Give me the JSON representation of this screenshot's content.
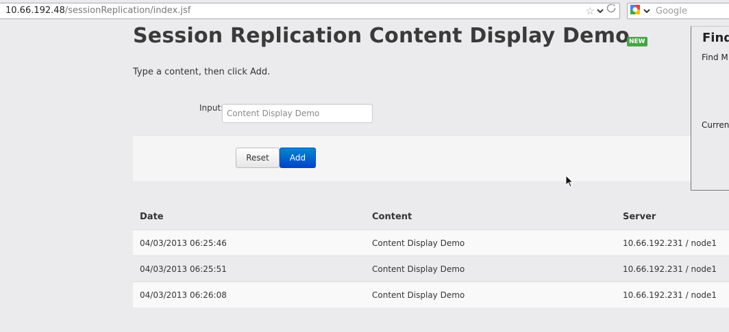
{
  "browser": {
    "url_host": "10.66.192.48",
    "url_path": "/sessionReplication/index.jsf",
    "search_placeholder": "Google"
  },
  "page": {
    "title": "Session Replication Content Display Demo",
    "badge": "NEW",
    "instructions": "Type a content, then click Add."
  },
  "form": {
    "input_label": "Input:",
    "input_placeholder": "Content Display Demo",
    "reset_label": "Reset",
    "add_label": "Add"
  },
  "table": {
    "headers": {
      "date": "Date",
      "content": "Content",
      "server": "Server"
    },
    "rows": [
      {
        "date": "04/03/2013 06:25:46",
        "content": "Content Display Demo",
        "server": "10.66.192.231 / node1"
      },
      {
        "date": "04/03/2013 06:25:51",
        "content": "Content Display Demo",
        "server": "10.66.192.231 / node1"
      },
      {
        "date": "04/03/2013 06:26:08",
        "content": "Content Display Demo",
        "server": "10.66.192.231 / node1"
      }
    ]
  },
  "find_panel": {
    "title": "Find",
    "subtitle": "Find M",
    "current": "Curren"
  },
  "colors": {
    "page_bg": "#ebebed",
    "badge_green": "#46a546",
    "primary_blue": "#0074cc"
  },
  "icons": [
    "bookmark-star-icon",
    "dropdown-chevron-icon",
    "reload-icon",
    "google-search-engine-icon",
    "mouse-cursor-icon"
  ]
}
